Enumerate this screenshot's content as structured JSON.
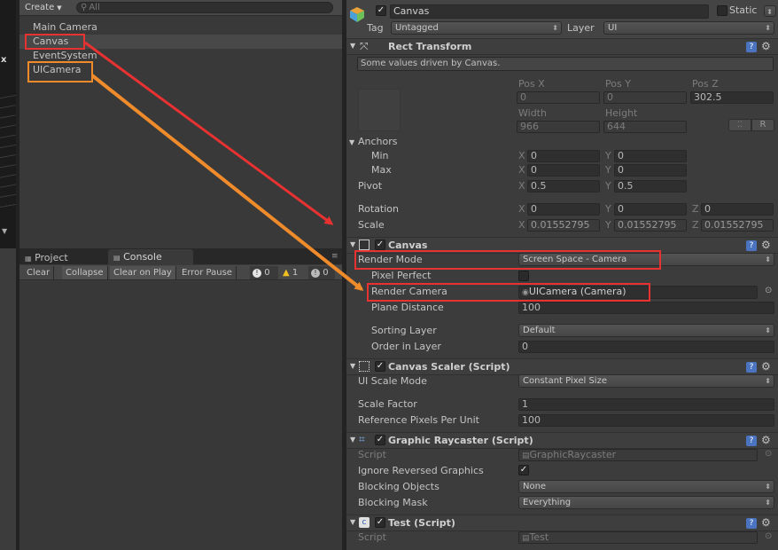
{
  "toolbar": {
    "create_label": "Create",
    "search_placeholder": "All"
  },
  "hierarchy": {
    "items": [
      "Main Camera",
      "Canvas",
      "EventSystem",
      "UICamera"
    ]
  },
  "bottom_tabs": {
    "project": "Project",
    "console": "Console"
  },
  "console_bar": {
    "clear": "Clear",
    "collapse": "Collapse",
    "clear_on_play": "Clear on Play",
    "error_pause": "Error Pause",
    "info_count": "0",
    "warn_count": "1",
    "error_count": "0"
  },
  "object": {
    "name": "Canvas",
    "static_label": "Static",
    "tag_label": "Tag",
    "tag_value": "Untagged",
    "layer_label": "Layer",
    "layer_value": "UI"
  },
  "rect_transform": {
    "title": "Rect Transform",
    "note": "Some values driven by Canvas.",
    "col_labels": [
      "Pos X",
      "Pos Y",
      "Pos Z"
    ],
    "pos": [
      "0",
      "0",
      "302.5"
    ],
    "size_labels": [
      "Width",
      "Height"
    ],
    "size": [
      "966",
      "644"
    ],
    "r_button": "R",
    "anchors": "Anchors",
    "min": "Min",
    "max": "Max",
    "anchor_min": [
      "0",
      "0"
    ],
    "anchor_max": [
      "0",
      "0"
    ],
    "pivot": "Pivot",
    "pivot_values": [
      "0.5",
      "0.5"
    ],
    "rotation": "Rotation",
    "rotation_values": [
      "0",
      "0",
      "0"
    ],
    "scale": "Scale",
    "scale_values": [
      "0.01552795",
      "0.01552795",
      "0.01552795"
    ],
    "axes": [
      "X",
      "Y",
      "Z"
    ]
  },
  "canvas": {
    "title": "Canvas",
    "render_mode_label": "Render Mode",
    "render_mode_value": "Screen Space - Camera",
    "pixel_perfect_label": "Pixel Perfect",
    "render_camera_label": "Render Camera",
    "render_camera_value": "UICamera (Camera)",
    "plane_distance_label": "Plane Distance",
    "plane_distance_value": "100",
    "sorting_layer_label": "Sorting Layer",
    "sorting_layer_value": "Default",
    "order_label": "Order in Layer",
    "order_value": "0"
  },
  "scaler": {
    "title": "Canvas Scaler (Script)",
    "mode_label": "UI Scale Mode",
    "mode_value": "Constant Pixel Size",
    "factor_label": "Scale Factor",
    "factor_value": "1",
    "ref_label": "Reference Pixels Per Unit",
    "ref_value": "100"
  },
  "raycaster": {
    "title": "Graphic Raycaster (Script)",
    "script_label": "Script",
    "script_value": "GraphicRaycaster",
    "ignore_label": "Ignore Reversed Graphics",
    "blocking_label": "Blocking Objects",
    "blocking_value": "None",
    "mask_label": "Blocking Mask",
    "mask_value": "Everything"
  },
  "test": {
    "title": "Test (Script)",
    "script_label": "Script",
    "script_value": "Test"
  },
  "scene_label": "x",
  "colors": {
    "highlight_red": "#e83232",
    "highlight_orange": "#f08b2c",
    "help_blue": "#4a74c0"
  }
}
